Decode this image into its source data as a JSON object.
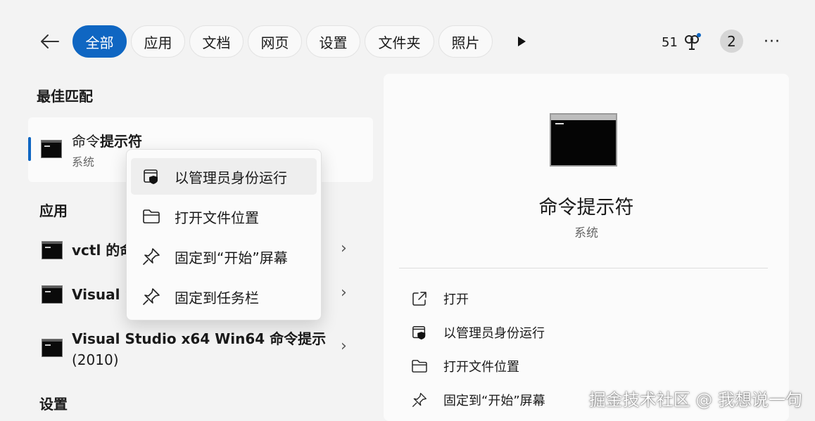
{
  "nav": {
    "chips": [
      "全部",
      "应用",
      "文档",
      "网页",
      "设置",
      "文件夹",
      "照片"
    ],
    "points": "51",
    "avatar_letter": "2",
    "more_glyph": "···"
  },
  "left": {
    "best_heading": "最佳匹配",
    "best_title_prefix": "命令",
    "best_title_bold": "提示符",
    "best_sub": "系统",
    "apps_heading": "应用",
    "apps": [
      {
        "line1": "vctl 的命",
        "line2": ""
      },
      {
        "line1": "Visual St",
        "line2": ""
      },
      {
        "line1": "Visual Studio x64 Win64 命令提示",
        "line2": "(2010)"
      }
    ],
    "settings_heading": "设置"
  },
  "context_menu": [
    {
      "label": "以管理员身份运行",
      "icon": "admin-shield-icon"
    },
    {
      "label": "打开文件位置",
      "icon": "folder-icon"
    },
    {
      "label": "固定到“开始”屏幕",
      "icon": "pin-icon"
    },
    {
      "label": "固定到任务栏",
      "icon": "pin-icon"
    }
  ],
  "detail": {
    "title": "命令提示符",
    "subtitle": "系统",
    "actions": [
      {
        "label": "打开",
        "icon": "open-external-icon"
      },
      {
        "label": "以管理员身份运行",
        "icon": "admin-shield-icon"
      },
      {
        "label": "打开文件位置",
        "icon": "folder-icon"
      },
      {
        "label": "固定到“开始”屏幕",
        "icon": "pin-icon"
      }
    ]
  },
  "watermark": "掘金技术社区 @ 我想说一句",
  "colors": {
    "accent": "#0f66c2",
    "background": "#f3f3f3"
  }
}
